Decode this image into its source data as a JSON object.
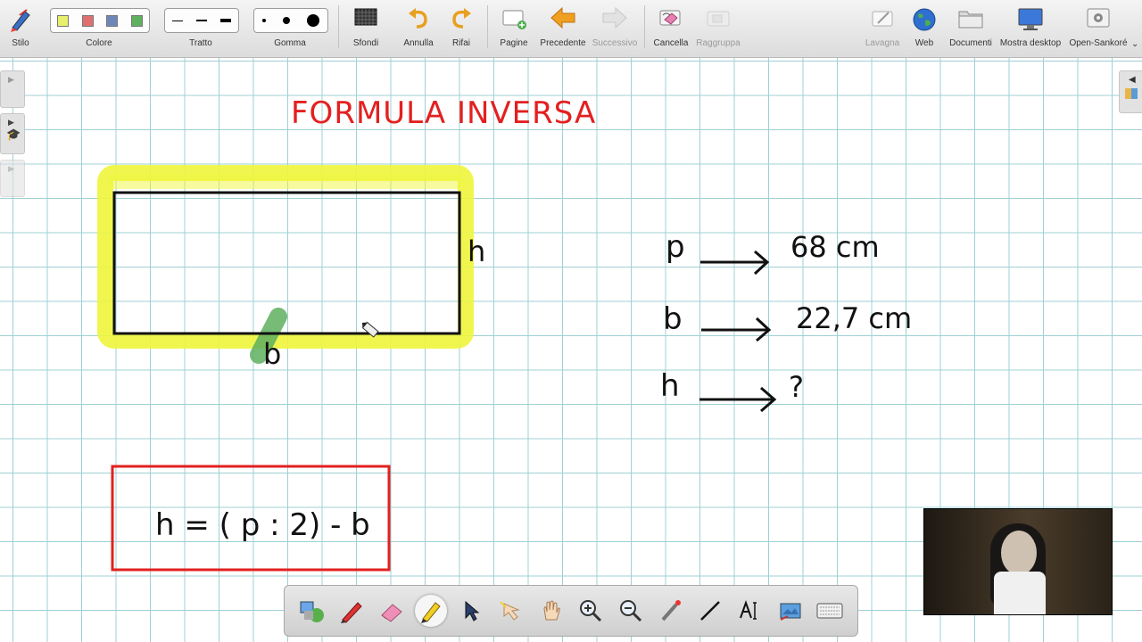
{
  "toolbar": {
    "stilo": "Stilo",
    "colore": "Colore",
    "tratto": "Tratto",
    "gomma": "Gomma",
    "sfondi": "Sfondi",
    "annulla": "Annulla",
    "rifai": "Rifai",
    "pagine": "Pagine",
    "precedente": "Precedente",
    "successivo": "Successivo",
    "cancella": "Cancella",
    "raggruppa": "Raggruppa",
    "lavagna": "Lavagna",
    "web": "Web",
    "documenti": "Documenti",
    "mostra_desktop": "Mostra desktop",
    "open_sankore": "Open-Sankoré",
    "colors": [
      "#e6f06a",
      "#e07070",
      "#6e86b8",
      "#5fb05f"
    ]
  },
  "board": {
    "title": "FORMULA INVERSA",
    "label_h": "h",
    "label_b": "b",
    "rows": [
      {
        "var": "p",
        "value": "68 cm"
      },
      {
        "var": "b",
        "value": "22,7 cm"
      },
      {
        "var": "h",
        "value": "?"
      }
    ],
    "formula": "h = ( p : 2) - b",
    "highlight_color": "#f0f53c",
    "title_color": "#e32020",
    "formula_border_color": "#e32020"
  },
  "bottom_toolbar": {
    "icons": [
      "interactive-tool-icon",
      "pen-icon",
      "eraser-icon",
      "highlighter-icon",
      "selector-icon",
      "play-icon",
      "hand-icon",
      "zoom-in-icon",
      "zoom-out-icon",
      "laser-pointer-icon",
      "line-icon",
      "text-icon",
      "capture-icon",
      "keyboard-icon"
    ]
  }
}
